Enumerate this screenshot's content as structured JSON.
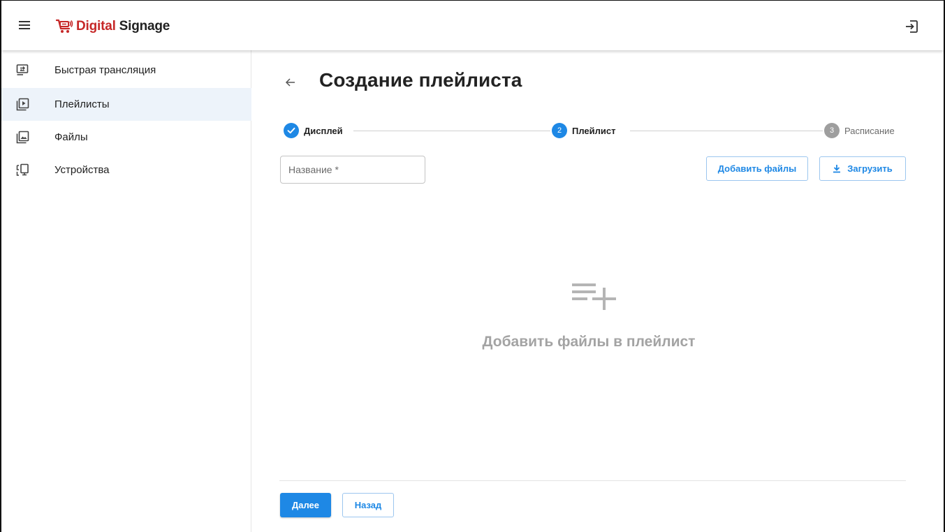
{
  "header": {
    "logo_part1": "Digital",
    "logo_part2": "Signage",
    "menu_icon": "hamburger-menu-icon",
    "logout_icon": "logout-icon",
    "brand_color": "#c62828"
  },
  "sidebar": {
    "items": [
      {
        "label": "Быстрая трансляция",
        "icon": "quick-cast-icon",
        "active": false
      },
      {
        "label": "Плейлисты",
        "icon": "playlist-play-icon",
        "active": true
      },
      {
        "label": "Файлы",
        "icon": "image-file-icon",
        "active": false
      },
      {
        "label": "Устройства",
        "icon": "devices-icon",
        "active": false
      }
    ]
  },
  "main": {
    "title": "Создание плейлиста",
    "back_icon": "arrow-left-icon",
    "stepper": {
      "steps": [
        {
          "number": "1",
          "label": "Дисплей",
          "state": "completed"
        },
        {
          "number": "2",
          "label": "Плейлист",
          "state": "active"
        },
        {
          "number": "3",
          "label": "Расписание",
          "state": "inactive"
        }
      ]
    },
    "name_field": {
      "placeholder": "Название *",
      "value": ""
    },
    "add_files_button": "Добавить файлы",
    "upload_button": "Загрузить",
    "empty_state": {
      "icon": "playlist-add-icon",
      "text": "Добавить файлы в плейлист"
    },
    "next_button": "Далее",
    "back_button": "Назад"
  },
  "colors": {
    "accent": "#1e88e5",
    "step_inactive": "#9e9e9e",
    "active_nav_bg": "#edf3fa",
    "empty_text": "#a3a3a3"
  }
}
